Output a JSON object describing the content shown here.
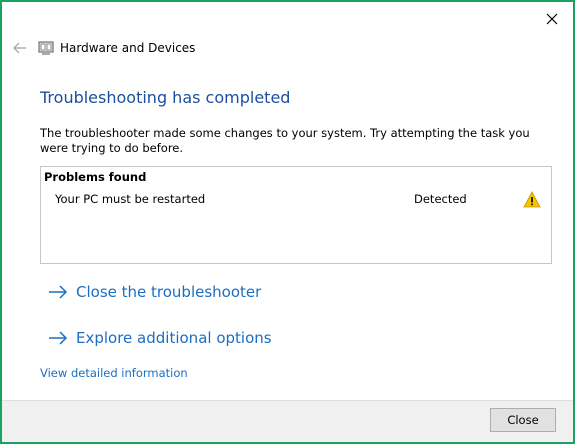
{
  "window": {
    "close_icon": "close-icon"
  },
  "header": {
    "back_icon": "back-arrow-icon",
    "app_icon": "hardware-devices-icon",
    "title": "Hardware and Devices"
  },
  "main": {
    "heading": "Troubleshooting has completed",
    "description": "The troubleshooter made some changes to your system. Try attempting the task you were trying to do before.",
    "problems": {
      "header": "Problems found",
      "rows": [
        {
          "name": "Your PC must be restarted",
          "status": "Detected",
          "icon": "warning-icon"
        }
      ]
    },
    "links": {
      "close_troubleshooter": "Close the troubleshooter",
      "explore_options": "Explore additional options",
      "detailed_info": "View detailed information"
    }
  },
  "footer": {
    "close_label": "Close"
  },
  "colors": {
    "window_border": "#1aa260",
    "heading": "#1b4fa0",
    "link": "#1b6ec2",
    "warning": "#f5c400",
    "footer_bg": "#f0f0f0"
  }
}
